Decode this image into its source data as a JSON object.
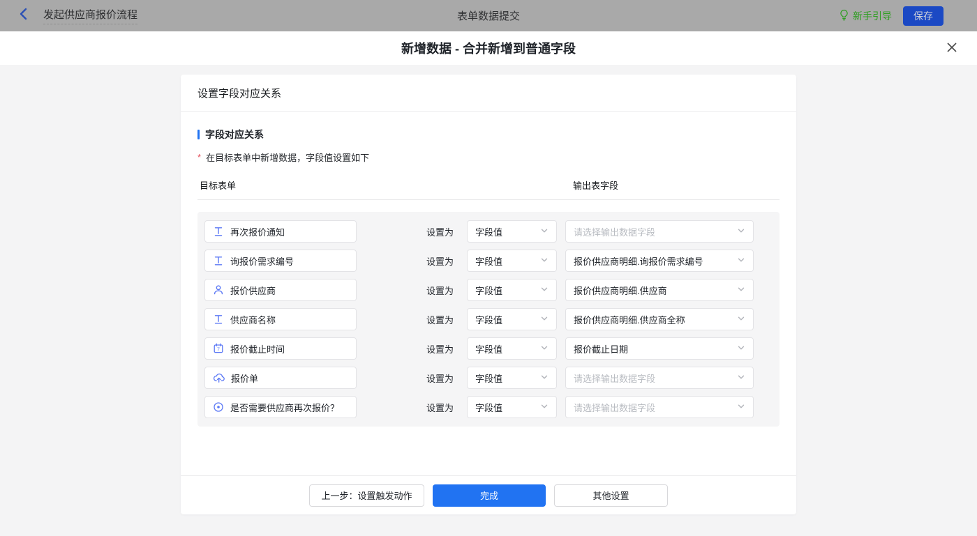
{
  "topbar": {
    "flow_title": "发起供应商报价流程",
    "center_title": "表单数据提交",
    "guide_label": "新手引导",
    "save_label": "保存"
  },
  "modal": {
    "title": "新增数据 - 合并新增到普通字段",
    "close_glyph": "✕"
  },
  "card": {
    "header": "设置字段对应关系",
    "section_title": "字段对应关系",
    "hint_star": "*",
    "hint": "在目标表单中新增数据，字段值设置如下",
    "col_target": "目标表单",
    "col_output": "输出表字段",
    "set_as_label": "设置为",
    "rows": [
      {
        "icon": "text-icon",
        "field": "再次报价通知",
        "mode": "字段值",
        "output": "请选择输出数据字段",
        "is_placeholder": true
      },
      {
        "icon": "text-icon",
        "field": "询报价需求编号",
        "mode": "字段值",
        "output": "报价供应商明细.询报价需求编号",
        "is_placeholder": false
      },
      {
        "icon": "person-icon",
        "field": "报价供应商",
        "mode": "字段值",
        "output": "报价供应商明细.供应商",
        "is_placeholder": false
      },
      {
        "icon": "text-icon",
        "field": "供应商名称",
        "mode": "字段值",
        "output": "报价供应商明细.供应商全称",
        "is_placeholder": false
      },
      {
        "icon": "calendar-icon",
        "field": "报价截止时间",
        "mode": "字段值",
        "output": "报价截止日期",
        "is_placeholder": false
      },
      {
        "icon": "upload-icon",
        "field": "报价单",
        "mode": "字段值",
        "output": "请选择输出数据字段",
        "is_placeholder": true
      },
      {
        "icon": "radio-icon",
        "field": "是否需要供应商再次报价？",
        "mode": "字段值",
        "output": "请选择输出数据字段",
        "is_placeholder": true
      }
    ],
    "footer": {
      "prev_label": "上一步：设置触发动作",
      "done_label": "完成",
      "other_label": "其他设置"
    }
  },
  "colors": {
    "primary-blue": "#2173f2",
    "save-blue": "#1b49c4",
    "guide-green": "#2f9e22",
    "star-red": "#e34d59",
    "icon-blue": "#5b78f5"
  }
}
